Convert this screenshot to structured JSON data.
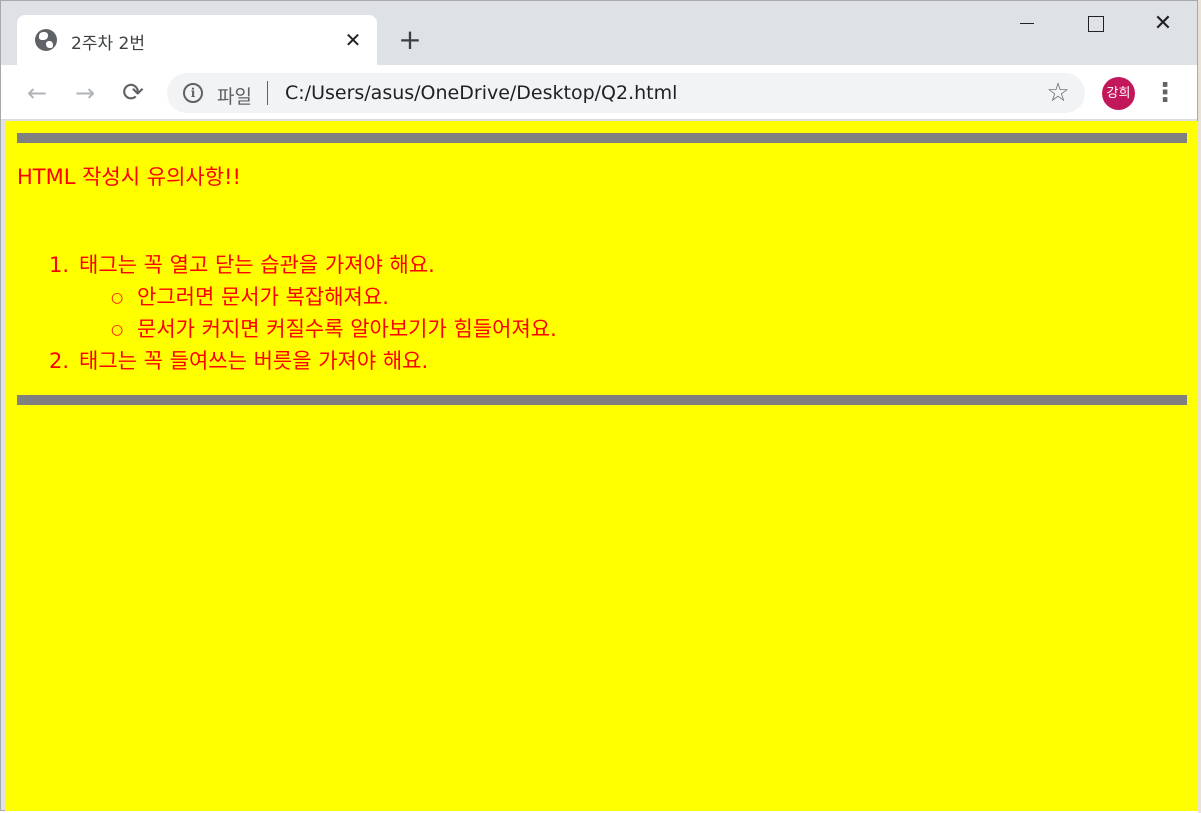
{
  "tab": {
    "title": "2주차 2번",
    "close_glyph": "✕",
    "new_tab_glyph": "+"
  },
  "window_controls": {
    "close_glyph": "✕"
  },
  "toolbar": {
    "back_glyph": "←",
    "forward_glyph": "→",
    "reload_glyph": "⟳",
    "info_glyph": "i",
    "scheme": "파일",
    "url": "C:/Users/asus/OneDrive/Desktop/Q2.html",
    "star_glyph": "☆",
    "avatar_text": "강희",
    "menu_glyph": "⋮"
  },
  "page": {
    "background": "#ffff00",
    "text_color": "#ff0000",
    "rule_color": "#808080",
    "heading": "HTML 작성시 유의사항!!",
    "items": [
      {
        "num": "1.",
        "text": "태그는 꼭 열고 닫는 습관을 가져야 해요."
      },
      {
        "num": "2.",
        "text": "태그는 꼭 들여쓰는 버릇을 가져야 해요."
      }
    ],
    "subitems": [
      {
        "bullet": "○",
        "text": "안그러면 문서가 복잡해져요."
      },
      {
        "bullet": "○",
        "text": "문서가 커지면 커질수록 알아보기가 힘들어져요."
      }
    ]
  }
}
